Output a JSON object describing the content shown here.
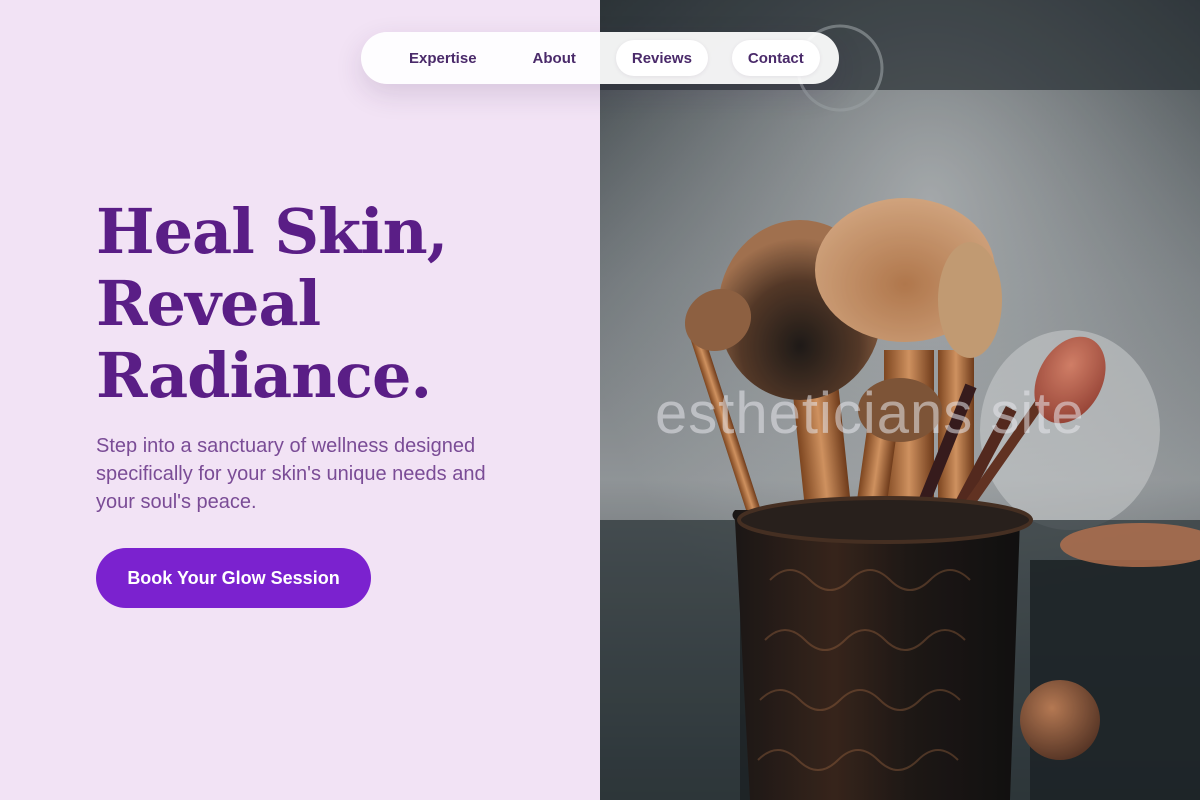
{
  "nav": {
    "items": [
      {
        "label": "Expertise"
      },
      {
        "label": "About"
      },
      {
        "label": "Reviews"
      },
      {
        "label": "Contact"
      }
    ]
  },
  "hero": {
    "title_lines": [
      "Heal Skin,",
      "Reveal",
      "Radiance."
    ],
    "subtitle": "Step into a sanctuary of wellness designed specifically for your skin's unique needs and your soul's peace.",
    "cta_label": "Book Your Glow Session"
  },
  "image": {
    "watermark": "estheticians site",
    "subject": "makeup-brushes-in-holder"
  },
  "colors": {
    "left_background": "#f2e3f5",
    "heading": "#5a1e86",
    "body_text": "#7a4c96",
    "cta_background": "#7b22cf",
    "cta_text": "#ffffff",
    "nav_text": "#4a2a6a"
  }
}
